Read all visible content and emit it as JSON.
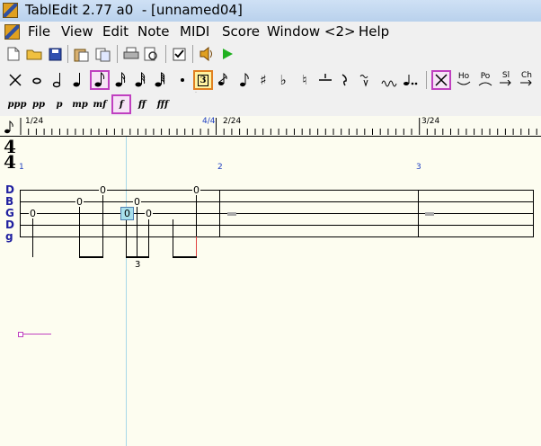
{
  "window": {
    "title": "TablEdit 2.77 a0  - [unnamed04]"
  },
  "menu": [
    "File",
    "View",
    "Edit",
    "Note",
    "MIDI",
    "Score",
    "Window <2>",
    "Help"
  ],
  "toolbar2": {
    "tuplet": "3",
    "hammer_on": "Ho",
    "pull_off": "Po",
    "slide": "Sl",
    "chord": "Ch"
  },
  "dynamics": [
    "ppp",
    "pp",
    "p",
    "mp",
    "mf",
    "f",
    "ff",
    "fff"
  ],
  "ruler": {
    "labels": [
      "1/24",
      "4/4",
      "2/24",
      "3/24"
    ]
  },
  "score": {
    "time_signature": {
      "top": "4",
      "bottom": "4"
    },
    "measures": [
      "1",
      "2",
      "3"
    ],
    "strings": [
      "D",
      "B",
      "G",
      "D",
      "g"
    ],
    "notes": [
      {
        "fret": "0",
        "string": 2
      },
      {
        "fret": "0",
        "string": 1
      },
      {
        "fret": "0",
        "string": 0
      },
      {
        "fret": "0",
        "string": 2,
        "selected": true
      },
      {
        "fret": "0",
        "string": 1
      },
      {
        "fret": "0",
        "string": 2
      },
      {
        "fret": "0",
        "string": 0
      }
    ],
    "triplet_label": "3"
  },
  "colors": {
    "selection": "#c040c0",
    "measure_number": "#2040c0",
    "cursor": "#a8d8e8"
  }
}
